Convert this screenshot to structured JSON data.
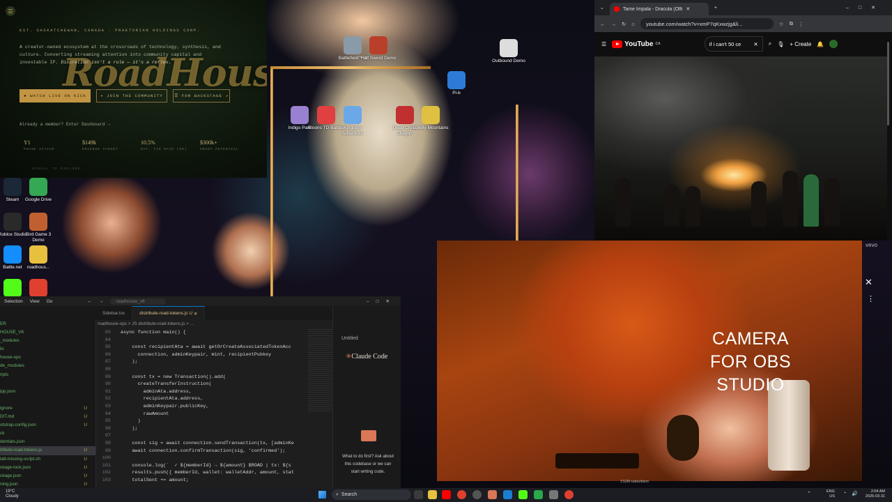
{
  "roadhouse": {
    "tagline": "EST. SASKATCHEWAN, CANADA · PRAETORIAN HOLDINGS CORP.",
    "description_part1": "A creator-owned ecosystem at the crossroads of technology, synthesis, and culture. Converting streaming attention into community capital and investable IP. ",
    "description_part2": "Discretion isn't a rule — it's a reflex.",
    "logo_text": "RoadHouse",
    "buttons": [
      "● WATCH LIVE ON KICK",
      "✦ JOIN THE COMMUNITY",
      "☰ FOR BACKSTAGE ↗"
    ],
    "member_text": "Already a member? Enter Dashboard →",
    "stats": [
      {
        "value": "Y1",
        "label": "PHASE ACTIVE"
      },
      {
        "value": "$149k",
        "label": "REVENUE TARGET"
      },
      {
        "value": "10.5%",
        "label": "EFF. TAX RATE (SK)"
      },
      {
        "value": "$300k+",
        "label": "GRANT POTENTIAL"
      }
    ],
    "scroll_text": "SCROLL TO EXPLORE"
  },
  "desktop_icons": [
    {
      "label": "Battlefield™ 6",
      "icon": "battlefield-icon",
      "color": "#8a9aa8"
    },
    {
      "label": "Half Sword Demo",
      "icon": "half-sword-icon",
      "color": "#b8402a"
    },
    {
      "label": "Outbound Demo",
      "icon": "outbound-icon",
      "color": "#dddddd"
    },
    {
      "label": "Pi-b",
      "icon": "p-app-icon",
      "color": "#2d7bd6"
    },
    {
      "label": "Indigo Park",
      "icon": "indigo-park-icon",
      "color": "#9a80d0"
    },
    {
      "label": "Bloons TD Battles",
      "icon": "bloons-icon",
      "color": "#e04040"
    },
    {
      "label": "Kingdom Adventure",
      "icon": "kingdom-icon",
      "color": "#6aa8e8"
    },
    {
      "label": "Dead Cross Dragon",
      "icon": "dragon-icon",
      "color": "#c03030"
    },
    {
      "label": "Lonely Mountains",
      "icon": "lonely-icon",
      "color": "#e0c040"
    },
    {
      "label": "Steam",
      "icon": "steam-icon",
      "color": "#1b2838"
    },
    {
      "label": "Google Drive",
      "icon": "google-drive-icon",
      "color": "#34a853"
    },
    {
      "label": "Roblox Studio",
      "icon": "roblox-studio-icon",
      "color": "#2a2a2a"
    },
    {
      "label": "Bird Game 3 Demo",
      "icon": "bird-game-icon",
      "color": "#c06030"
    },
    {
      "label": "Battle.net",
      "icon": "battlenet-icon",
      "color": "#148eff"
    },
    {
      "label": "roadhous...",
      "icon": "folder-icon",
      "color": "#e8c040"
    },
    {
      "label": "",
      "icon": "kick-app-icon",
      "color": "#53fc18"
    },
    {
      "label": "",
      "icon": "chrome-icon",
      "color": "#e04030"
    }
  ],
  "youtube": {
    "tab_title": "Tame Impala - Dracula (Offi",
    "url": "youtube.com/watch?v=xmP7qKxwzjg&li...",
    "logo": "YouTube",
    "logo_region": "CA",
    "search_value": "if i can't 50 ce",
    "create_label": "Create",
    "vevo": "vevo",
    "subscribers": "3.52M subscribers"
  },
  "camera": {
    "label": "CAMERA FOR OBS STUDIO",
    "close": "✕",
    "menu": "⋮"
  },
  "vscode": {
    "title_menu": [
      "Selection",
      "View",
      "Go"
    ],
    "search": "roadhouse_v6",
    "project": "HOUSE_V6",
    "tabs": [
      "Sidebar.tsx",
      "distribute-road-tokens.js  U"
    ],
    "breadcrumb": "roadhouse-ops  >  JS distribute-road-tokens.js  >  ...",
    "files": [
      {
        "name": "ER",
        "mark": ""
      },
      {
        "name": "HOUSE_V6",
        "mark": ""
      },
      {
        "name": "_modules",
        "mark": ""
      },
      {
        "name": "lic",
        "mark": ""
      },
      {
        "name": "house-ops",
        "mark": ""
      },
      {
        "name": "de_modules",
        "mark": ""
      },
      {
        "name": "ripts",
        "mark": ""
      },
      {
        "name": "",
        "mark": ""
      },
      {
        "name": "ipp.json",
        "mark": ""
      },
      {
        "name": "",
        "mark": ""
      },
      {
        "name": "ignore",
        "mark": "U"
      },
      {
        "name": "DIT.md",
        "mark": "U"
      },
      {
        "name": "otstrap.config.json",
        "mark": "U"
      },
      {
        "name": "ck",
        "mark": ""
      },
      {
        "name": "dentials.json",
        "mark": ""
      },
      {
        "name": "tribute-road-tokens.js",
        "mark": "U"
      },
      {
        "name": "tall-missing-script.sh",
        "mark": "U"
      },
      {
        "name": "ckage-lock.json",
        "mark": "U"
      },
      {
        "name": "ckage.json",
        "mark": "U"
      },
      {
        "name": "ning.json",
        "mark": "U"
      },
      {
        "name": "up.sh",
        "mark": "U"
      }
    ],
    "code": [
      {
        "n": "83",
        "t": "async function main() {"
      },
      {
        "n": "84",
        "t": ""
      },
      {
        "n": "85",
        "t": "    const recipientAta = await getOrCreateAssociatedTokenAcc"
      },
      {
        "n": "86",
        "t": "      connection, adminKeypair, mint, recipientPubkey"
      },
      {
        "n": "87",
        "t": "    );"
      },
      {
        "n": "88",
        "t": ""
      },
      {
        "n": "89",
        "t": "    const tx = new Transaction().add("
      },
      {
        "n": "90",
        "t": "      createTransferInstruction("
      },
      {
        "n": "91",
        "t": "        adminAta.address,"
      },
      {
        "n": "92",
        "t": "        recipientAta.address,"
      },
      {
        "n": "93",
        "t": "        adminKeypair.publicKey,"
      },
      {
        "n": "94",
        "t": "        rawAmount"
      },
      {
        "n": "95",
        "t": "      )"
      },
      {
        "n": "96",
        "t": "    );"
      },
      {
        "n": "97",
        "t": ""
      },
      {
        "n": "98",
        "t": "    const sig = await connection.sendTransaction(tx, [adminKe"
      },
      {
        "n": "99",
        "t": "    await connection.confirmTransaction(sig, 'confirmed');"
      },
      {
        "n": "100",
        "t": ""
      },
      {
        "n": "101",
        "t": "    console.log(`  ✓ ${memberId} → ${amount} $ROAD | tx: ${s"
      },
      {
        "n": "102",
        "t": "    results.push({ memberId, wallet: walletAddr, amount, stat"
      },
      {
        "n": "103",
        "t": "    totalSent += amount;"
      }
    ],
    "claude_panel_title": "Untitled",
    "claude_logo": "Claude Code",
    "claude_prompt": "What to do first? Ask about this codebase or we can start writing code."
  },
  "taskbar": {
    "weather_temp": "19°C",
    "weather_desc": "Cloudy",
    "search_placeholder": "Search",
    "lang": "ENG",
    "region": "US",
    "time": "2:04 AM",
    "date": "2026-03-31"
  }
}
